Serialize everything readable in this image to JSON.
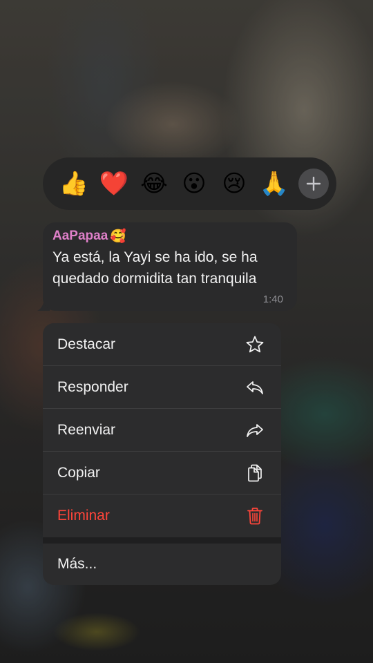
{
  "reactions": {
    "items": [
      {
        "emoji": "👍",
        "icon": "thumbs-up-icon"
      },
      {
        "emoji": "❤️",
        "icon": "red-heart-icon"
      },
      {
        "emoji": "😂",
        "icon": "face-with-tears-of-joy-icon"
      },
      {
        "emoji": "😮",
        "icon": "face-with-open-mouth-icon"
      },
      {
        "emoji": "😢",
        "icon": "crying-face-icon"
      },
      {
        "emoji": "🙏",
        "icon": "folded-hands-icon"
      }
    ],
    "more_icon": "plus-icon"
  },
  "message": {
    "sender": "AaPapaa",
    "sender_emoji": "🥰",
    "text": "Ya está, la Yayi se ha ido, se ha quedado dormidita tan tranquila",
    "time": "1:40"
  },
  "menu": {
    "items": [
      {
        "label": "Destacar",
        "icon": "star-icon"
      },
      {
        "label": "Responder",
        "icon": "reply-icon"
      },
      {
        "label": "Reenviar",
        "icon": "forward-icon"
      },
      {
        "label": "Copiar",
        "icon": "copy-icon"
      },
      {
        "label": "Eliminar",
        "icon": "trash-icon",
        "color": "#ff453a"
      }
    ],
    "more_label": "Más..."
  },
  "colors": {
    "sender_name": "#df80c9",
    "danger": "#ff453a",
    "menu_background": "#2c2c2d",
    "bubble_background": "#2a2a2b"
  }
}
